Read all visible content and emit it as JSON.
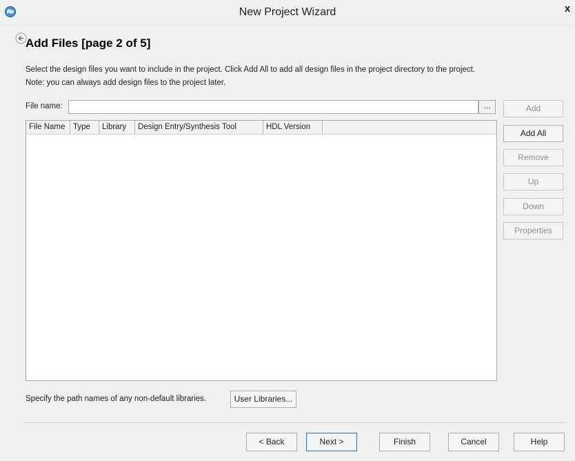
{
  "window": {
    "title": "New Project Wizard",
    "close_label": "x"
  },
  "page": {
    "heading": "Add Files [page 2 of 5]",
    "description_line1": "Select the design files you want to include in the project. Click Add All to add all design files in the project directory to the project.",
    "description_line2": "Note: you can always add design files to the project later."
  },
  "file_input": {
    "label": "File name:",
    "value": "",
    "browse_label": "..."
  },
  "file_list": {
    "columns": [
      "File Name",
      "Type",
      "Library",
      "Design Entry/Synthesis Tool",
      "HDL Version"
    ],
    "rows": []
  },
  "side_buttons": {
    "add": "Add",
    "add_all": "Add All",
    "remove": "Remove",
    "up": "Up",
    "down": "Down",
    "properties": "Properties"
  },
  "libraries": {
    "label": "Specify the path names of any non-default libraries.",
    "button": "User Libraries..."
  },
  "nav_buttons": {
    "back": "< Back",
    "next": "Next >",
    "finish": "Finish",
    "cancel": "Cancel",
    "help": "Help"
  },
  "colors": {
    "accent": "#3c7fb1",
    "disabled_text": "#8f8f8f",
    "icon_blue": "#4a8fd0"
  },
  "icons": {
    "app": "globe-icon",
    "back": "back-arrow-icon"
  }
}
